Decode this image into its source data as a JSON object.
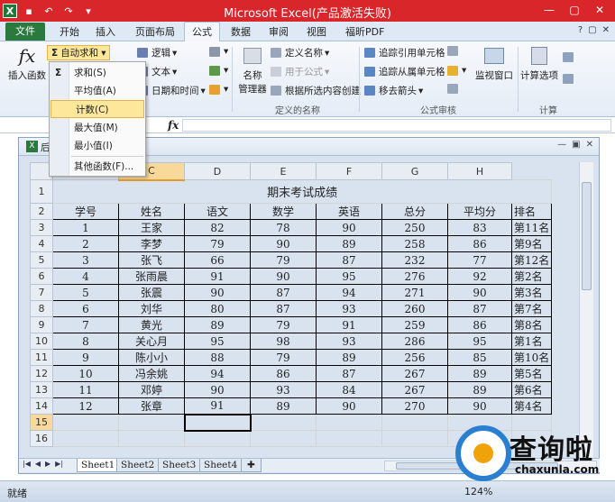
{
  "window": {
    "title": "Microsoft Excel(产品激活失败)"
  },
  "ribbon_tabs": [
    "开始",
    "插入",
    "页面布局",
    "公式",
    "数据",
    "审阅",
    "视图",
    "福昕PDF"
  ],
  "file_tab": "文件",
  "ribbon": {
    "insert_function": "插入函数",
    "autosum": "自动求和",
    "logic": "逻辑",
    "text": "文本",
    "datetime": "日期和时间",
    "name_manager_1": "名称",
    "name_manager_2": "管理器",
    "define_name": "定义名称",
    "use_in_formula": "用于公式",
    "create_from_selection": "根据所选内容创建",
    "defined_names_group": "定义的名称",
    "trace_precedents": "追踪引用单元格",
    "trace_dependents": "追踪从属单元格",
    "remove_arrows": "移去箭头",
    "formula_audit_group": "公式审核",
    "watch_window": "监视窗口",
    "calc_options": "计算选项",
    "calc_group": "计算"
  },
  "autosum_menu": {
    "sigma": "Σ",
    "items": [
      "求和(S)",
      "平均值(A)",
      "计数(C)",
      "最大值(M)",
      "最小值(I)",
      "其他函数(F)..."
    ]
  },
  "formula_bar": {
    "fx": "fx",
    "value": ""
  },
  "workbook": {
    "name_prefix": "后"
  },
  "sheet": {
    "columns": [
      "B",
      "C",
      "D",
      "E",
      "F",
      "G",
      "H"
    ],
    "first_col_label": "",
    "title": "期末考试成绩",
    "headers": [
      "学号",
      "姓名",
      "语文",
      "数学",
      "英语",
      "总分",
      "平均分",
      "排名"
    ],
    "rows": [
      [
        "1",
        "王家",
        "82",
        "78",
        "90",
        "250",
        "83",
        "第11名"
      ],
      [
        "2",
        "李梦",
        "79",
        "90",
        "89",
        "258",
        "86",
        "第9名"
      ],
      [
        "3",
        "张飞",
        "66",
        "79",
        "87",
        "232",
        "77",
        "第12名"
      ],
      [
        "4",
        "张雨晨",
        "91",
        "90",
        "95",
        "276",
        "92",
        "第2名"
      ],
      [
        "5",
        "张震",
        "90",
        "87",
        "94",
        "271",
        "90",
        "第3名"
      ],
      [
        "6",
        "刘华",
        "80",
        "87",
        "93",
        "260",
        "87",
        "第7名"
      ],
      [
        "7",
        "黄光",
        "89",
        "79",
        "91",
        "259",
        "86",
        "第8名"
      ],
      [
        "8",
        "关心月",
        "95",
        "98",
        "93",
        "286",
        "95",
        "第1名"
      ],
      [
        "9",
        "陈小小",
        "88",
        "79",
        "89",
        "256",
        "85",
        "第10名"
      ],
      [
        "10",
        "冯余姚",
        "94",
        "86",
        "87",
        "267",
        "89",
        "第5名"
      ],
      [
        "11",
        "邓婷",
        "90",
        "93",
        "84",
        "267",
        "89",
        "第6名"
      ],
      [
        "12",
        "张章",
        "91",
        "89",
        "90",
        "270",
        "90",
        "第4名"
      ]
    ],
    "row_numbers": [
      "1",
      "2",
      "3",
      "4",
      "5",
      "6",
      "7",
      "8",
      "9",
      "10",
      "11",
      "12",
      "13",
      "14",
      "15",
      "16"
    ]
  },
  "sheet_tabs": [
    "Sheet1",
    "Sheet2",
    "Sheet3",
    "Sheet4"
  ],
  "status": {
    "ready": "就绪",
    "zoom": "124%"
  },
  "watermark": {
    "text": "查询啦",
    "url": "chaxunla.com"
  }
}
